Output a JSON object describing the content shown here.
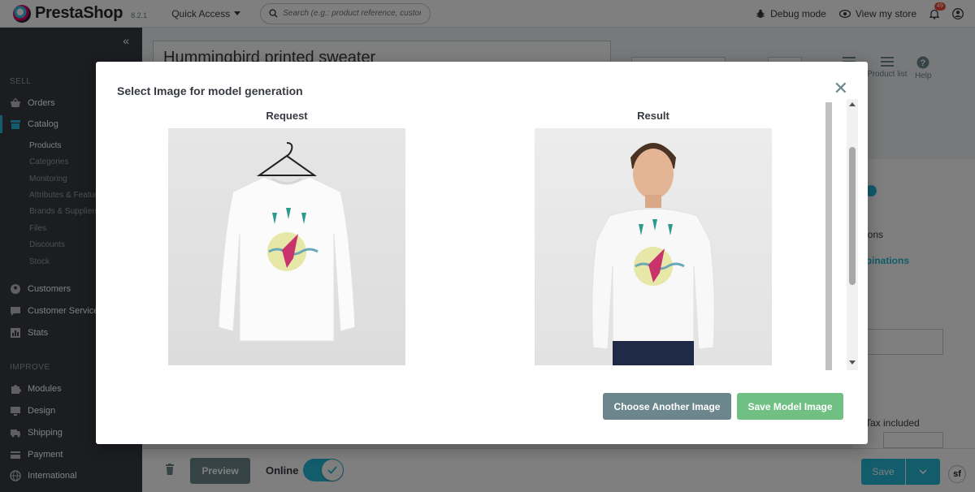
{
  "header": {
    "logo_text": "PrestaShop",
    "version": "8.2.1",
    "quick_access": "Quick Access",
    "search_placeholder": "Search (e.g.: product reference, custon",
    "debug_mode": "Debug mode",
    "view_store": "View my store",
    "notification_count": "49"
  },
  "sidebar": {
    "sell_title": "SELL",
    "improve_title": "IMPROVE",
    "items": {
      "orders": "Orders",
      "catalog": "Catalog",
      "customers": "Customers",
      "customer_service": "Customer Service",
      "stats": "Stats",
      "modules": "Modules",
      "design": "Design",
      "shipping": "Shipping",
      "payment": "Payment",
      "international": "International"
    },
    "catalog_sub": [
      "Products",
      "Categories",
      "Monitoring",
      "Attributes & Features",
      "Brands & Suppliers",
      "Files",
      "Discounts",
      "Stock"
    ]
  },
  "page": {
    "product_name": "Hummingbird printed sweater",
    "tool_product_list": "Product list",
    "tool_help": "Help",
    "card_combinations_text": "ations",
    "card_combinations_link": "mbinations",
    "card_tax": "Tax included"
  },
  "footer": {
    "preview": "Preview",
    "online": "Online",
    "save": "Save"
  },
  "modal": {
    "title": "Select Image for model generation",
    "request_label": "Request",
    "result_label": "Result",
    "choose_another": "Choose Another Image",
    "save_model": "Save Model Image"
  },
  "colors": {
    "primary": "#25b9d7",
    "sidebar": "#363a41",
    "secondary_button": "#6c868e",
    "success_button": "#70c084"
  }
}
